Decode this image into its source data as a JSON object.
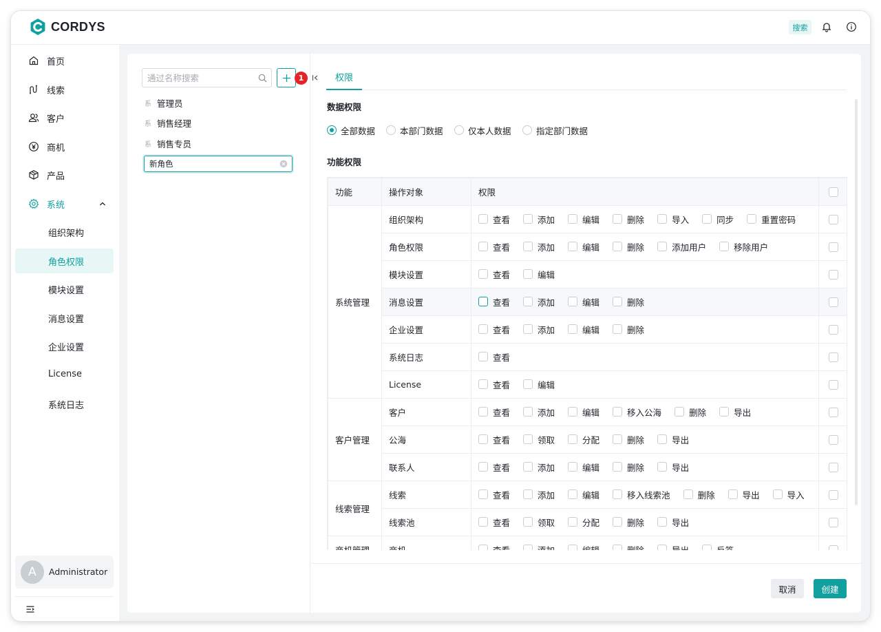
{
  "app": {
    "brand": "CORDYS",
    "search_label": "搜索"
  },
  "sidebar": {
    "items": [
      {
        "label": "首页",
        "icon": "home-icon"
      },
      {
        "label": "线索",
        "icon": "clue-icon"
      },
      {
        "label": "客户",
        "icon": "customer-icon"
      },
      {
        "label": "商机",
        "icon": "yen-icon"
      },
      {
        "label": "产品",
        "icon": "cube-icon"
      },
      {
        "label": "系统",
        "icon": "gear-icon",
        "expanded": true
      }
    ],
    "sub_items": [
      {
        "label": "组织架构"
      },
      {
        "label": "角色权限",
        "active": true
      },
      {
        "label": "模块设置"
      },
      {
        "label": "消息设置"
      },
      {
        "label": "企业设置"
      },
      {
        "label": "License"
      },
      {
        "label": "系统日志"
      }
    ],
    "user": {
      "initial": "A",
      "name": "Administrator"
    }
  },
  "roles": {
    "search_placeholder": "通过名称搜索",
    "badge": "1",
    "items": [
      {
        "tag": "系",
        "name": "管理员"
      },
      {
        "tag": "系",
        "name": "销售经理"
      },
      {
        "tag": "系",
        "name": "销售专员"
      }
    ],
    "new_role_value": "新角色"
  },
  "permissions": {
    "tab": "权限",
    "data_title": "数据权限",
    "data_options": [
      "全部数据",
      "本部门数据",
      "仅本人数据",
      "指定部门数据"
    ],
    "data_selected": 0,
    "func_title": "功能权限",
    "headers": [
      "功能",
      "操作对象",
      "权限"
    ],
    "groups": [
      {
        "module": "系统管理",
        "rows": [
          {
            "object": "组织架构",
            "perms": [
              "查看",
              "添加",
              "编辑",
              "删除",
              "导入",
              "同步",
              "重置密码"
            ]
          },
          {
            "object": "角色权限",
            "perms": [
              "查看",
              "添加",
              "编辑",
              "删除",
              "添加用户",
              "移除用户"
            ]
          },
          {
            "object": "模块设置",
            "perms": [
              "查看",
              "编辑"
            ]
          },
          {
            "object": "消息设置",
            "perms": [
              "查看",
              "添加",
              "编辑",
              "删除"
            ],
            "highlight": true
          },
          {
            "object": "企业设置",
            "perms": [
              "查看",
              "添加",
              "编辑",
              "删除"
            ]
          },
          {
            "object": "系统日志",
            "perms": [
              "查看"
            ]
          },
          {
            "object": "License",
            "perms": [
              "查看",
              "编辑"
            ]
          }
        ]
      },
      {
        "module": "客户管理",
        "rows": [
          {
            "object": "客户",
            "perms": [
              "查看",
              "添加",
              "编辑",
              "移入公海",
              "删除",
              "导出"
            ]
          },
          {
            "object": "公海",
            "perms": [
              "查看",
              "领取",
              "分配",
              "删除",
              "导出"
            ]
          },
          {
            "object": "联系人",
            "perms": [
              "查看",
              "添加",
              "编辑",
              "删除",
              "导出"
            ]
          }
        ]
      },
      {
        "module": "线索管理",
        "rows": [
          {
            "object": "线索",
            "perms": [
              "查看",
              "添加",
              "编辑",
              "移入线索池",
              "删除",
              "导出",
              "导入"
            ]
          },
          {
            "object": "线索池",
            "perms": [
              "查看",
              "领取",
              "分配",
              "删除",
              "导出"
            ]
          }
        ]
      },
      {
        "module": "商机管理",
        "rows": [
          {
            "object": "商机",
            "perms": [
              "查看",
              "添加",
              "编辑",
              "删除",
              "导出",
              "反签"
            ]
          }
        ]
      }
    ],
    "cancel": "取消",
    "create": "创建"
  }
}
